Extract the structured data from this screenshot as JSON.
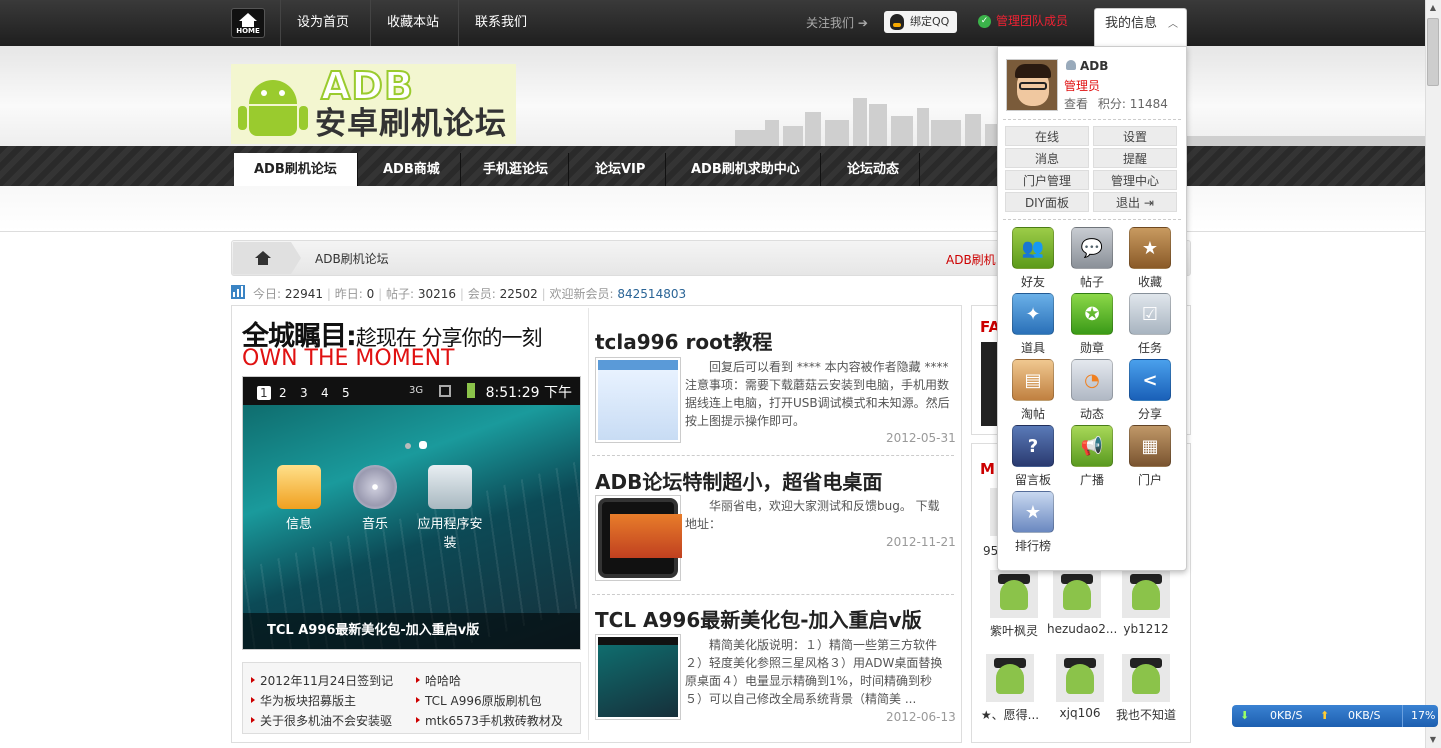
{
  "topbar": {
    "home_label": "HOME",
    "links": [
      "设为首页",
      "收藏本站",
      "联系我们"
    ],
    "follow": "关注我们",
    "qq_bind": "绑定QQ",
    "admin_team": "管理团队成员",
    "myinfo": "我的信息"
  },
  "logo": {
    "en": "ADB",
    "zh": "安卓刷机论坛"
  },
  "nav": [
    "ADB刷机论坛",
    "ADB商城",
    "手机逛论坛",
    "论坛VIP",
    "ADB刷机求助中心",
    "论坛动态"
  ],
  "breadcrumb": {
    "current": "ADB刷机论坛",
    "right": "ADB刷机"
  },
  "stats": {
    "today_label": "今日:",
    "today": "22941",
    "yesterday_label": "昨日:",
    "yesterday": "0",
    "posts_label": "帖子:",
    "posts": "30216",
    "members_label": "会员:",
    "members": "22502",
    "newest_label": "欢迎新会员:",
    "newest": "842514803"
  },
  "feature": {
    "slogan_big": "全城瞩目:",
    "slogan_small": "趁现在 分享你的一刻",
    "slogan_en": "OWN THE MOMENT",
    "slide_nums": [
      "1",
      "2",
      "3",
      "4",
      "5"
    ],
    "time": "8:51:29 下午",
    "signal": "3G",
    "apps": [
      "信息",
      "音乐",
      "应用程序安装"
    ],
    "caption": "TCL A996最新美化包-加入重启v版"
  },
  "links": [
    "2012年11月24日签到记",
    "哈哈哈",
    "华为板块招募版主",
    "TCL A996原版刷机包",
    "关于很多机油不会安装驱",
    "mtk6573手机救砖教材及"
  ],
  "articles": [
    {
      "title": "tcla996 root教程",
      "desc": "回复后可以看到 **** 本内容被作者隐藏 **** 注意事项：需要下载蘑菇云安装到电脑，手机用数据线连上电脑，打开USB调试模式和未知源。然后按上图提示操作即可。",
      "date": "2012-05-31"
    },
    {
      "title": "ADB论坛特制超小，超省电桌面",
      "desc": "华丽省电，欢迎大家测试和反馈bug。 下载地址：",
      "date": "2012-11-21"
    },
    {
      "title": "TCL A996最新美化包-加入重启v版",
      "desc": "精简美化版说明：１）精简一些第三方软件 ２）轻度美化参照三星风格３）用ADW桌面替换原桌面４）电量显示精确到1%，时间精确到秒５）可以自己修改全局系统背景（精简美 ...",
      "date": "2012-06-13"
    }
  ],
  "sidebar": {
    "heading1": "FA",
    "heading2": "M",
    "partial_member": "95",
    "members": [
      "紫叶枫灵",
      "hezudao2...",
      "yb1212",
      "★、愿得...",
      "xjq106",
      "我也不知道"
    ]
  },
  "dropdown": {
    "username": "ADB",
    "role": "管理员",
    "view": "查看",
    "points_label": "积分:",
    "points": "11484",
    "buttons": [
      "在线",
      "设置",
      "消息",
      "提醒",
      "门户管理",
      "管理中心",
      "DIY面板",
      "退出"
    ],
    "tiles": [
      "好友",
      "帖子",
      "收藏",
      "道具",
      "勋章",
      "任务",
      "淘帖",
      "动态",
      "分享",
      "留言板",
      "广播",
      "门户",
      "排行榜"
    ]
  },
  "net": {
    "down": "0KB/S",
    "up": "0KB/S",
    "percent": "17%"
  },
  "colors": {
    "accent_red": "#e01111",
    "nav_dark": "#2a2a2a",
    "link_blue": "#2a6496"
  }
}
